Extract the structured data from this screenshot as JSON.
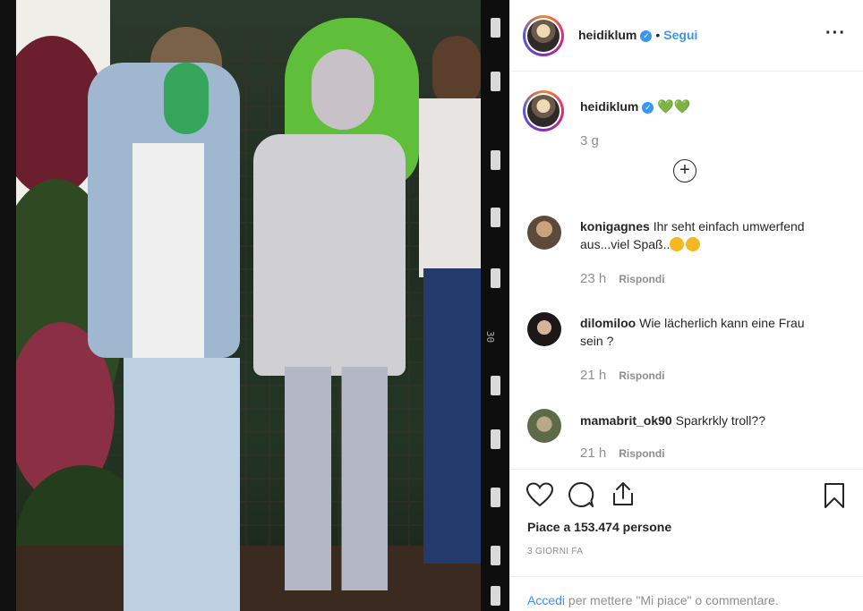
{
  "post": {
    "author": "heidiklum",
    "follow_label": "Segui",
    "separator": "•",
    "more_label": "···",
    "caption_author": "heidiklum",
    "caption_emojis": "💚💚",
    "caption_time": "3 g"
  },
  "comments": [
    {
      "user": "konigagnes",
      "text": "Ihr seht einfach umwerfend aus...viel Spaß..",
      "time": "23 h",
      "reply": "Rispondi"
    },
    {
      "user": "dilomiloo",
      "text": "Wie lächerlich kann eine Frau sein ?",
      "time": "21 h",
      "reply": "Rispondi"
    },
    {
      "user": "mamabrit_ok90",
      "text": "Sparkrkly troll??",
      "time": "21 h",
      "reply": "Rispondi"
    }
  ],
  "actions": {
    "likes": "Piace a 153.474 persone",
    "date": "3 GIORNI FA"
  },
  "login": {
    "link": "Accedi",
    "text": " per mettere \"Mi piace\" o commentare."
  },
  "film": {
    "number": "30"
  },
  "colors": {
    "accent": "#3897f0",
    "verified": "#3897f0",
    "muted": "#8e8e8e"
  }
}
